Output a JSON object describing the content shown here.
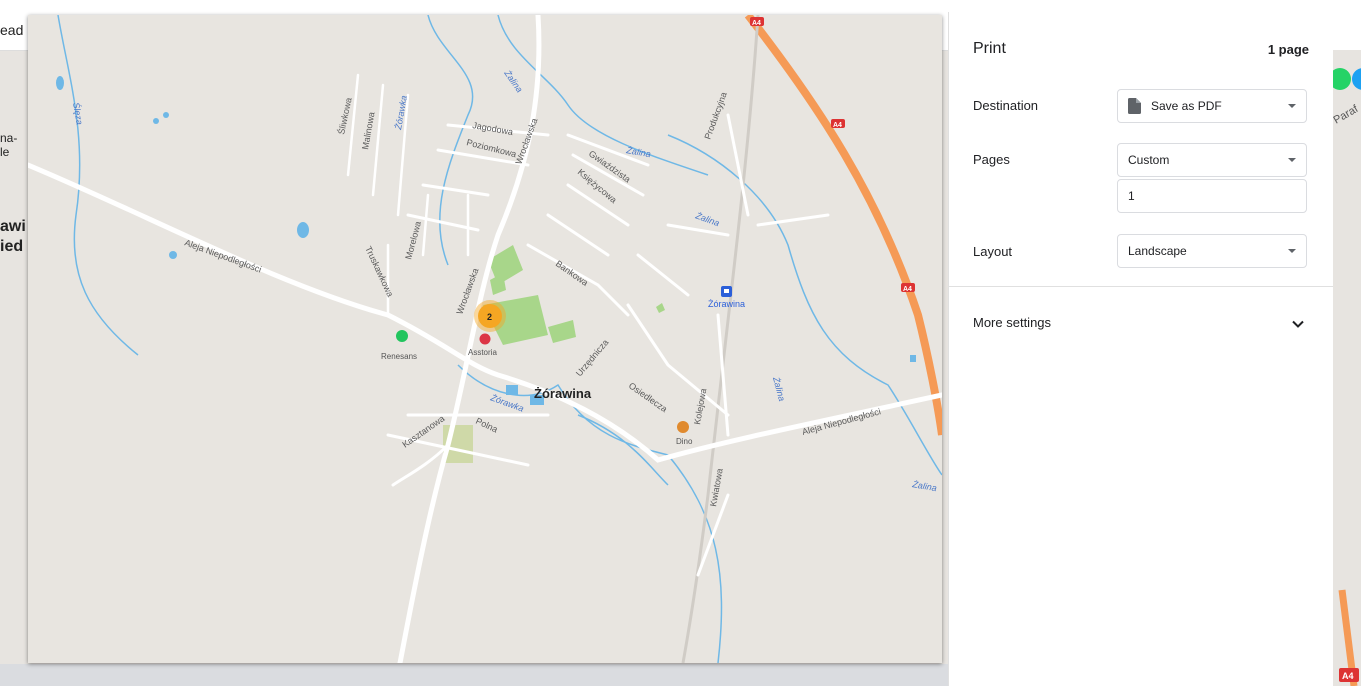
{
  "background": {
    "top_fragment": "ead",
    "left_fragments": [
      "na-",
      "le",
      "awi",
      "ied"
    ],
    "right_fragment": "Paraf",
    "highway_badge": "A4"
  },
  "print": {
    "title": "Print",
    "page_count": "1 page",
    "destination": {
      "label": "Destination",
      "value": "Save as PDF"
    },
    "pages": {
      "label": "Pages",
      "value": "Custom",
      "custom_value": "1"
    },
    "layout": {
      "label": "Layout",
      "value": "Landscape"
    },
    "more_settings": "More settings"
  },
  "map": {
    "town_label": "Żórawina",
    "station_label": "Żórawina",
    "highway_label": "A4",
    "cluster_count": "2",
    "poi": [
      {
        "name": "Renesans",
        "color": "#22c55e"
      },
      {
        "name": "Asstoria",
        "color": "#dc3545"
      },
      {
        "name": "Dino",
        "color": "#e08a2e"
      }
    ],
    "streets": {
      "aleja_west": "Aleja Niepodległości",
      "aleja_east": "Aleja Niepodległości",
      "wroclawska_south": "Wrocławska",
      "wroclawska_north": "Wrocławska",
      "sliwkowa": "Śliwkowa",
      "malinowa": "Malinowa",
      "jagodowa": "Jagodowa",
      "poziomkowa": "Poziomkowa",
      "gwiazdzista": "Gwiaździsta",
      "ksiezycowa": "Księżycowa",
      "produkcyjna": "Produkcyjna",
      "truskawkowa": "Truskawkowa",
      "morelowa": "Morelowa",
      "bankowa": "Bankowa",
      "urzednicza": "Urzędnicza",
      "osiedlecza": "Osiedlecza",
      "kolejowa": "Kolejowa",
      "kasztanowa": "Kasztanowa",
      "polna": "Polna",
      "kwiatowa": "Kwiatowa"
    },
    "water": {
      "zorawka_north": "Żórawka",
      "zorawka_south": "Żórawka",
      "sleza": "Ślęza",
      "zalina_1": "Żalina",
      "zalina_2": "Żalina",
      "zalina_3": "Żalina",
      "zalina_4": "Żalina",
      "zalina_5": "Żalina"
    },
    "colors": {
      "land": "#e8e5e0",
      "road": "#ffffff",
      "highway": "#f59a56",
      "water": "#6fb8e6",
      "park": "#a8d68a",
      "cluster": "#f5a623"
    }
  }
}
